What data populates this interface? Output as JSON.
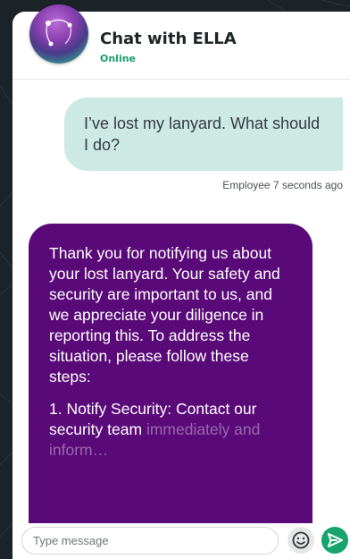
{
  "header": {
    "title": "Chat with ELLA",
    "status": "Online",
    "avatar_icon": "ella-orb-avatar"
  },
  "messages": {
    "user": {
      "text": "I’ve lost my lanyard. What should I do?",
      "meta": "Employee 7 seconds ago"
    },
    "bot": {
      "paragraph_1": "Thank you for notifying us about your lost lanyard. Your safety and security are important to us, and we appreciate your diligence in reporting this. To address the situation, please follow these steps:",
      "paragraph_2": "1. Notify Security: Contact our security team",
      "paragraph_2_faded": "immediately and inform…"
    }
  },
  "composer": {
    "placeholder": "Type message",
    "emoji_icon": "smiley-icon",
    "send_icon": "send-arrow-icon"
  },
  "colors": {
    "page_background": "#1b2228",
    "user_bubble": "#cde9e4",
    "bot_bubble": "#5a0a78",
    "status_green": "#1a9e6c",
    "send_green": "#17a56c"
  }
}
